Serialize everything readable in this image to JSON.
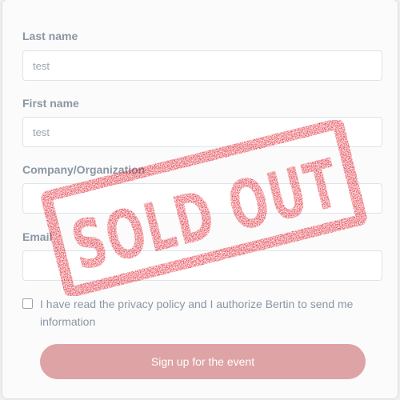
{
  "form": {
    "last_name": {
      "label": "Last name",
      "placeholder": "test"
    },
    "first_name": {
      "label": "First name",
      "placeholder": "test"
    },
    "company": {
      "label": "Company/Organization",
      "placeholder": ""
    },
    "email": {
      "label": "Email",
      "placeholder": ""
    },
    "consent_text": "I have read the privacy policy and I authorize Bertin to send me information",
    "submit_label": "Sign up for the event"
  },
  "stamp": {
    "text": "SOLD OUT",
    "color": "#e0101e"
  },
  "colors": {
    "button": "#dea3a5",
    "label": "#8a96a3"
  }
}
